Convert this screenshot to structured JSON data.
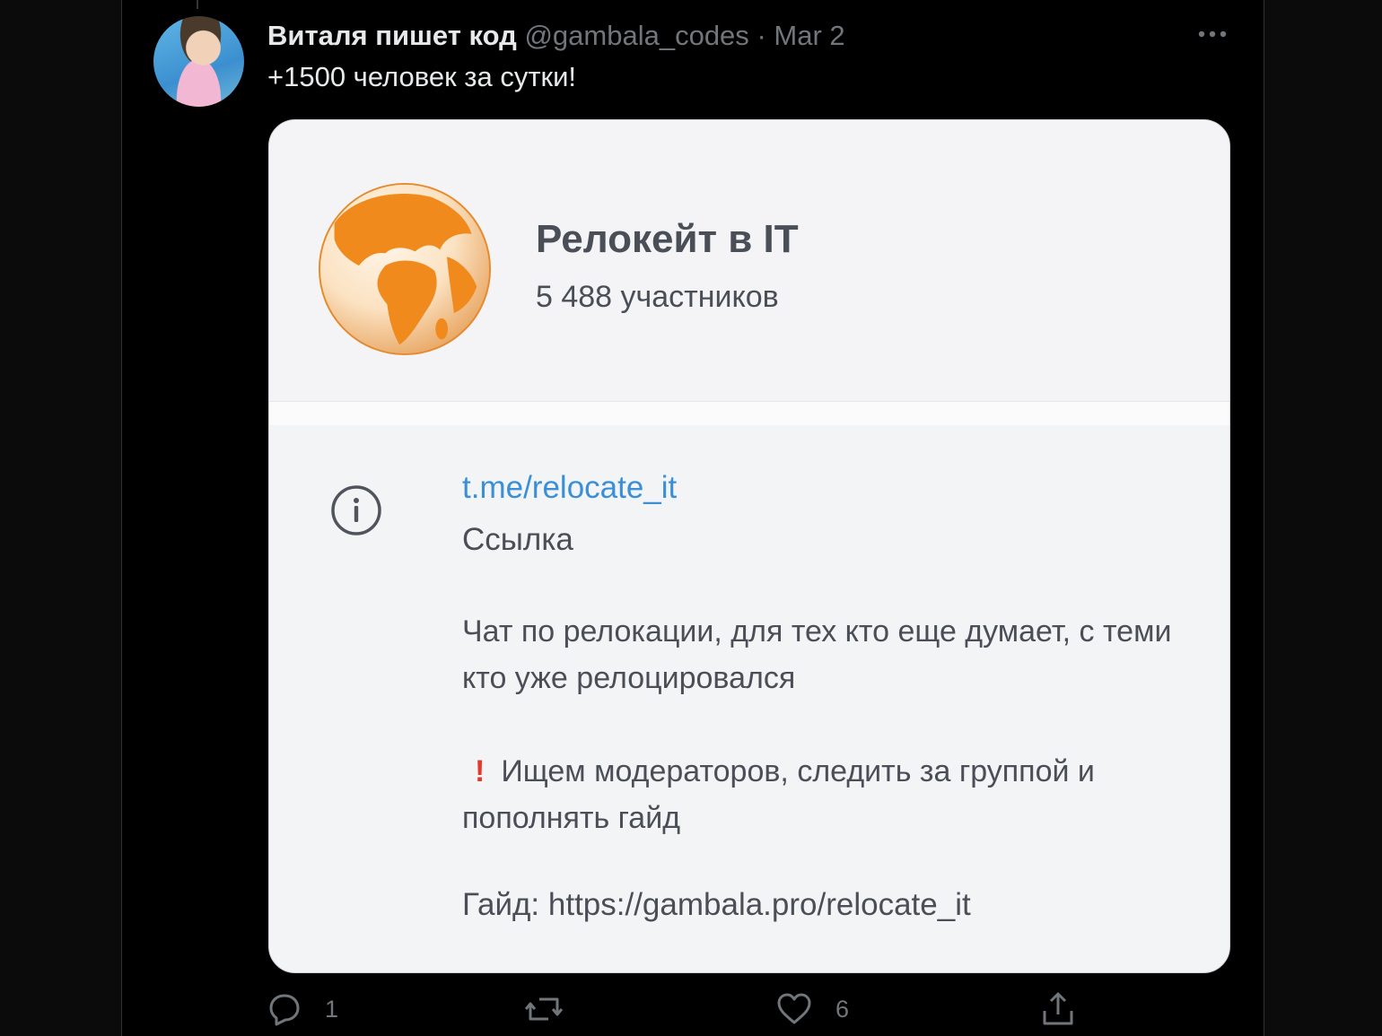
{
  "tweet": {
    "author_name": "Виталя пишет код",
    "handle": "@gambala_codes",
    "separator": "·",
    "date": "Mar 2",
    "text": "+1500 человек за сутки!"
  },
  "card": {
    "group_title": "Релокейт в IT",
    "members": "5 488 участников",
    "link": "t.me/relocate_it",
    "link_label": "Ссылка",
    "description": "Чат по релокации, для тех кто еще думает, с теми кто уже релоцировался",
    "moderators": "Ищем модераторов, следить за группой и пополнять гайд",
    "guide": "Гайд: https://gambala.pro/relocate_it"
  },
  "actions": {
    "reply_count": "1",
    "like_count": "6"
  },
  "icons": [
    "more-icon",
    "info-icon",
    "reply-icon",
    "retweet-icon",
    "like-icon",
    "share-icon",
    "exclamation-icon"
  ],
  "colors": {
    "background": "#000000",
    "text_primary": "#e7e9ea",
    "text_secondary": "#71767b",
    "link": "#3b8fd6",
    "globe": "#f08a1c",
    "exclamation": "#e23b2e"
  }
}
